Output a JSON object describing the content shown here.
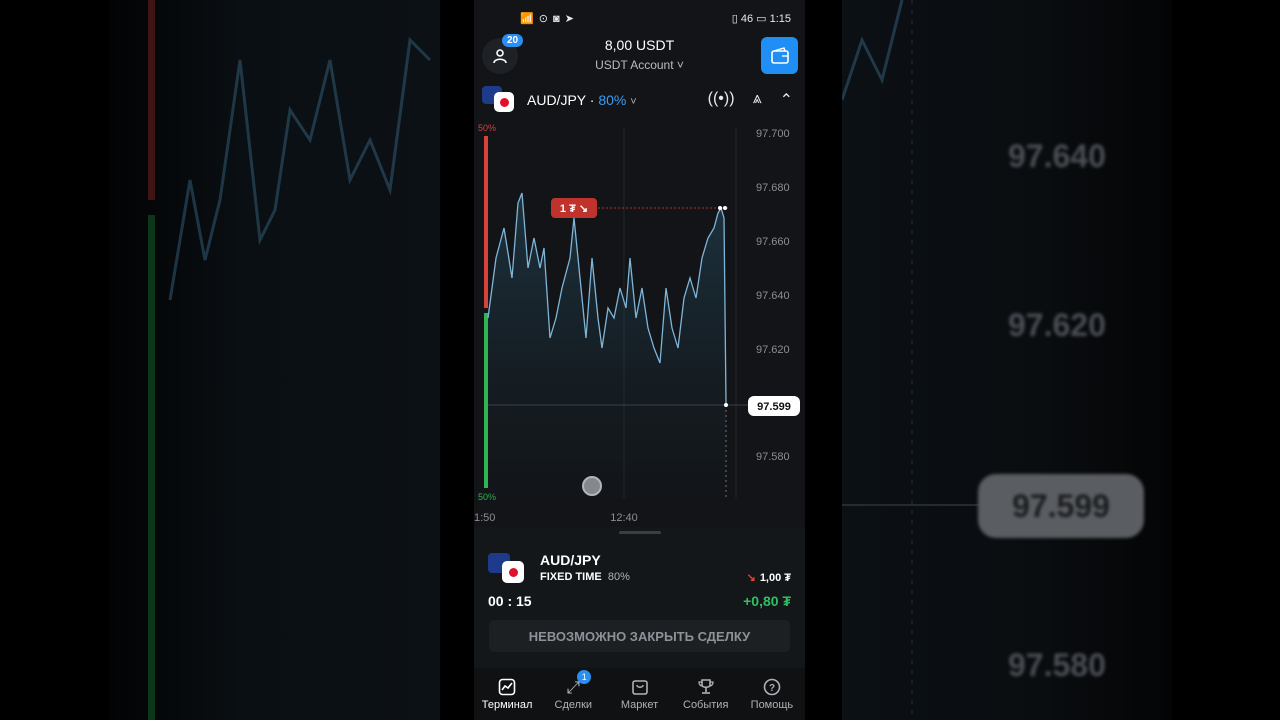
{
  "status": {
    "left": "📶 ⊙ ◙ ➤",
    "right": "▯ 46 ▭ 1:15"
  },
  "header": {
    "balance": "8,00 USDT",
    "account": "USDT Account ˅",
    "notifications": "20"
  },
  "asset": {
    "name": "AUD/JPY",
    "separator": " · ",
    "payout": "80%",
    "chevron": "˅"
  },
  "chart_data": {
    "type": "line",
    "price_ticks": [
      "97.700",
      "97.680",
      "97.660",
      "97.640",
      "97.620",
      "97.580"
    ],
    "time_ticks": [
      "1:50",
      "12:40"
    ],
    "current_price": "97.599",
    "trade_marker": "1 ₮ ↘",
    "sentiment_top": "50%",
    "sentiment_bottom": "50%"
  },
  "trade": {
    "name": "AUD/JPY",
    "type": "FIXED TIME",
    "payout": "80%",
    "amount": "1,00 ₮",
    "timer": "00 : 15",
    "profit": "+0,80 ₮",
    "close_label": "НЕВОЗМОЖНО ЗАКРЫТЬ СДЕЛКУ"
  },
  "nav": [
    {
      "label": "Терминал",
      "icon": "chart-icon"
    },
    {
      "label": "Сделки",
      "icon": "trades-icon",
      "badge": "1"
    },
    {
      "label": "Маркет",
      "icon": "bag-icon"
    },
    {
      "label": "События",
      "icon": "trophy-icon"
    },
    {
      "label": "Помощь",
      "icon": "help-icon"
    }
  ],
  "background": {
    "prices": [
      "97.640",
      "97.620",
      "97.580"
    ],
    "current": "97.599"
  },
  "colors": {
    "accent": "#1f8ff5",
    "profit": "#2fbf60",
    "loss": "#e0443a",
    "line": "#7fb5d9"
  }
}
